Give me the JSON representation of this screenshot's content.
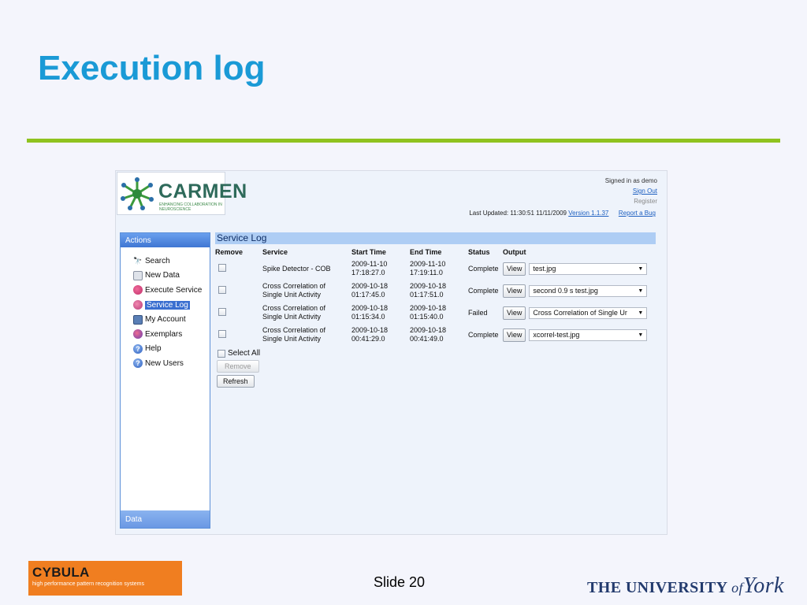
{
  "slide": {
    "title": "Execution log",
    "slide_number": "Slide 20"
  },
  "app": {
    "logo_word": "CARMEN",
    "logo_tagline": "ENHANCING COLLABORATION IN NEUROSCIENCE",
    "signed_in": "Signed in as demo",
    "sign_out": "Sign Out",
    "register": "Register",
    "last_updated": "Last Updated: 11:30:51 11/11/2009",
    "version": "Version 1.1.37",
    "report_bug": "Report a Bug"
  },
  "sidebar": {
    "header": "Actions",
    "footer": "Data",
    "items": [
      {
        "label": "Search",
        "icon": "binoculars-icon"
      },
      {
        "label": "New Data",
        "icon": "new-data-icon"
      },
      {
        "label": "Execute Service",
        "icon": "execute-service-icon"
      },
      {
        "label": "Service Log",
        "icon": "service-log-icon",
        "active": true
      },
      {
        "label": "My Account",
        "icon": "account-icon"
      },
      {
        "label": "Exemplars",
        "icon": "exemplars-icon"
      },
      {
        "label": "Help",
        "icon": "help-icon"
      },
      {
        "label": "New Users",
        "icon": "new-users-icon"
      }
    ]
  },
  "log": {
    "title": "Service Log",
    "columns": [
      "Remove",
      "Service",
      "Start Time",
      "End Time",
      "Status",
      "Output"
    ],
    "rows": [
      {
        "service": [
          "Spike Detector - COB",
          ""
        ],
        "start": [
          "2009-11-10",
          "17:18:27.0"
        ],
        "end": [
          "2009-11-10",
          "17:19:11.0"
        ],
        "status": "Complete",
        "view": "View",
        "output": "test.jpg"
      },
      {
        "service": [
          "Cross Correlation of",
          "Single Unit Activity"
        ],
        "start": [
          "2009-10-18",
          "01:17:45.0"
        ],
        "end": [
          "2009-10-18",
          "01:17:51.0"
        ],
        "status": "Complete",
        "view": "View",
        "output": "second 0.9 s test.jpg"
      },
      {
        "service": [
          "Cross Correlation of",
          "Single Unit Activity"
        ],
        "start": [
          "2009-10-18",
          "01:15:34.0"
        ],
        "end": [
          "2009-10-18",
          "01:15:40.0"
        ],
        "status": "Failed",
        "view": "View",
        "output": "Cross Correlation of Single Ur"
      },
      {
        "service": [
          "Cross Correlation of",
          "Single Unit Activity"
        ],
        "start": [
          "2009-10-18",
          "00:41:29.0"
        ],
        "end": [
          "2009-10-18",
          "00:41:49.0"
        ],
        "status": "Complete",
        "view": "View",
        "output": "xcorrel-test.jpg"
      }
    ],
    "select_all": "Select All",
    "remove_button": "Remove",
    "refresh_button": "Refresh"
  },
  "footer": {
    "cybula_name": "CYBULA",
    "cybula_tagline": "high performance pattern recognition systems",
    "york_the": "THE UNIVERSITY",
    "york_of": "of",
    "york_name": "York"
  },
  "colors": {
    "title": "#1a9ad6",
    "rule": "#8fc31f",
    "cybula": "#f07e20",
    "sidebar_header": "#3f76d3",
    "panel_header": "#aecdf4"
  }
}
